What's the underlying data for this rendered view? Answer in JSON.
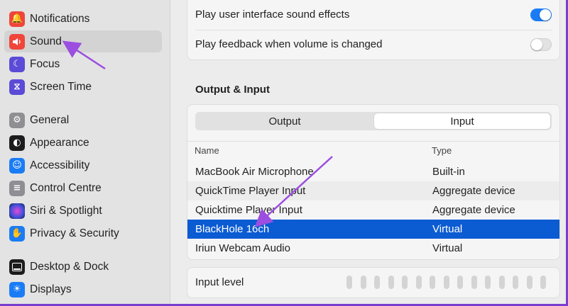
{
  "sidebar": {
    "items": [
      {
        "label": "Notifications",
        "icon": "bell-icon",
        "color": "#f0453a",
        "glyph": "♪"
      },
      {
        "label": "Sound",
        "icon": "speaker-icon",
        "color": "#f0453a",
        "glyph": "◀"
      },
      {
        "label": "Focus",
        "icon": "moon-icon",
        "color": "#5b4bd6",
        "glyph": "☾"
      },
      {
        "label": "Screen Time",
        "icon": "hourglass-icon",
        "color": "#5b4bd6",
        "glyph": "⧖"
      },
      {
        "label": "General",
        "icon": "gear-icon",
        "color": "#8e8e93",
        "glyph": "⚙"
      },
      {
        "label": "Appearance",
        "icon": "appearance-icon",
        "color": "#1c1c1e",
        "glyph": "◐"
      },
      {
        "label": "Accessibility",
        "icon": "accessibility-icon",
        "color": "#1a7cf5",
        "glyph": "☺"
      },
      {
        "label": "Control Centre",
        "icon": "control-centre-icon",
        "color": "#8e8e93",
        "glyph": "≡"
      },
      {
        "label": "Siri & Spotlight",
        "icon": "siri-icon",
        "color": "#2d2d6e",
        "glyph": "◉"
      },
      {
        "label": "Privacy & Security",
        "icon": "hand-icon",
        "color": "#1a7cf5",
        "glyph": "✋"
      },
      {
        "label": "Desktop & Dock",
        "icon": "dock-icon",
        "color": "#1c1c1e",
        "glyph": "▬"
      },
      {
        "label": "Displays",
        "icon": "sun-icon",
        "color": "#1a7cf5",
        "glyph": "☀"
      }
    ],
    "selected_index": 1
  },
  "sound_effects": {
    "ui_sounds_label": "Play user interface sound effects",
    "ui_sounds_on": true,
    "feedback_label": "Play feedback when volume is changed",
    "feedback_on": false
  },
  "output_input": {
    "title": "Output & Input",
    "tabs": [
      "Output",
      "Input"
    ],
    "active_tab": "Input",
    "columns": [
      "Name",
      "Type"
    ],
    "rows": [
      {
        "name": "MacBook Air Microphone",
        "type": "Built-in"
      },
      {
        "name": "QuickTime Player Input",
        "type": "Aggregate device"
      },
      {
        "name": "Quicktime Player Input",
        "type": "Aggregate device"
      },
      {
        "name": "BlackHole 16ch",
        "type": "Virtual"
      },
      {
        "name": "Iriun Webcam Audio",
        "type": "Virtual"
      }
    ],
    "selected_row": 3
  },
  "input_level": {
    "label": "Input level",
    "bar_count": 15,
    "level": 0
  },
  "colors": {
    "accent": "#1a7cf5",
    "selection": "#0b5bd3",
    "annotation_arrow": "#9b4ee0"
  }
}
